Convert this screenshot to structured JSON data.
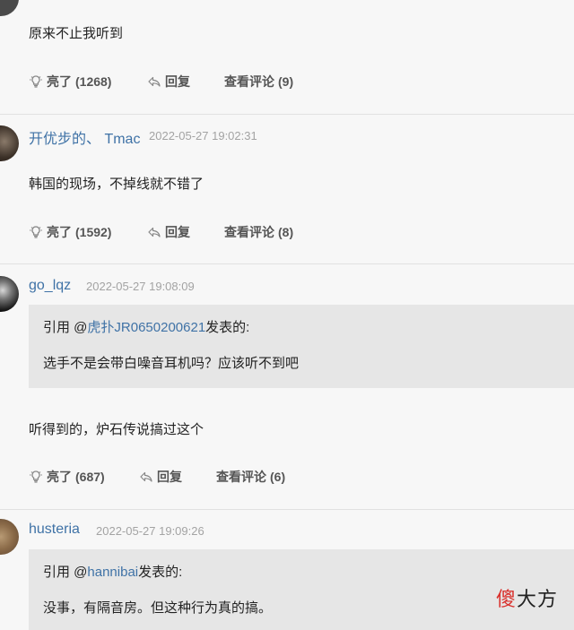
{
  "posts": [
    {
      "content": "原来不止我听到",
      "like_label": "亮了",
      "like_count": "(1268)",
      "reply_label": "回复",
      "view_label": "查看评论",
      "view_count": "(9)"
    },
    {
      "username": "开优步的、 Tmac",
      "timestamp": "2022-05-27 19:02:31",
      "content": "韩国的现场，不掉线就不错了",
      "like_label": "亮了",
      "like_count": "(1592)",
      "reply_label": "回复",
      "view_label": "查看评论",
      "view_count": "(8)"
    },
    {
      "username": "go_lqz",
      "timestamp": "2022-05-27 19:08:09",
      "quote_prefix": "引用 @",
      "quote_user": "虎扑JR0650200621",
      "quote_suffix": "发表的:",
      "quote_text": "选手不是会带白噪音耳机吗？应该听不到吧",
      "content": "听得到的，炉石传说搞过这个",
      "like_label": "亮了",
      "like_count": "(687)",
      "reply_label": "回复",
      "view_label": "查看评论",
      "view_count": "(6)"
    },
    {
      "username": "husteria",
      "timestamp": "2022-05-27 19:09:26",
      "quote_prefix": "引用 @",
      "quote_user": "hannibai",
      "quote_suffix": "发表的:",
      "quote_text": "没事，有隔音房。但这种行为真的搞。"
    }
  ],
  "watermark": {
    "part1": "傻",
    "part2": "大方"
  },
  "colors": {
    "username": "#3f72a6",
    "timestamp": "#a3a3a3",
    "quote_bg": "#e6e6e6",
    "divider": "#e1e1e1"
  }
}
